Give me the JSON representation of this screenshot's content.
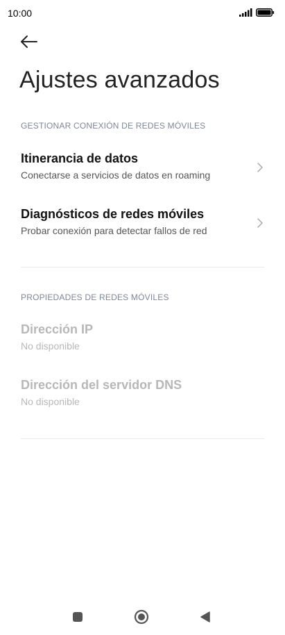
{
  "status_bar": {
    "time": "10:00",
    "signal_icon": "signal-bars-icon",
    "battery_icon": "battery-full-icon"
  },
  "header": {
    "back_icon": "arrow-left-icon",
    "title": "Ajustes avanzados"
  },
  "sections": [
    {
      "header": "GESTIONAR CONEXIÓN DE REDES MÓVILES",
      "items": [
        {
          "title": "Itinerancia de datos",
          "subtitle": "Conectarse a servicios de datos en roaming",
          "enabled": true,
          "chevron_icon": "chevron-right-icon"
        },
        {
          "title": "Diagnósticos de redes móviles",
          "subtitle": "Probar conexión para detectar fallos de red",
          "enabled": true,
          "chevron_icon": "chevron-right-icon"
        }
      ]
    },
    {
      "header": "PROPIEDADES DE REDES MÓVILES",
      "items": [
        {
          "title": "Dirección IP",
          "subtitle": "No disponible",
          "enabled": false
        },
        {
          "title": "Dirección del servidor DNS",
          "subtitle": "No disponible",
          "enabled": false
        }
      ]
    }
  ],
  "nav_bar": {
    "recents_icon": "square-icon",
    "home_icon": "circle-icon",
    "back_icon": "triangle-back-icon"
  },
  "colors": {
    "section_header": "#7e8699",
    "disabled_text": "#b7b7b7",
    "divider": "#ebebeb"
  }
}
